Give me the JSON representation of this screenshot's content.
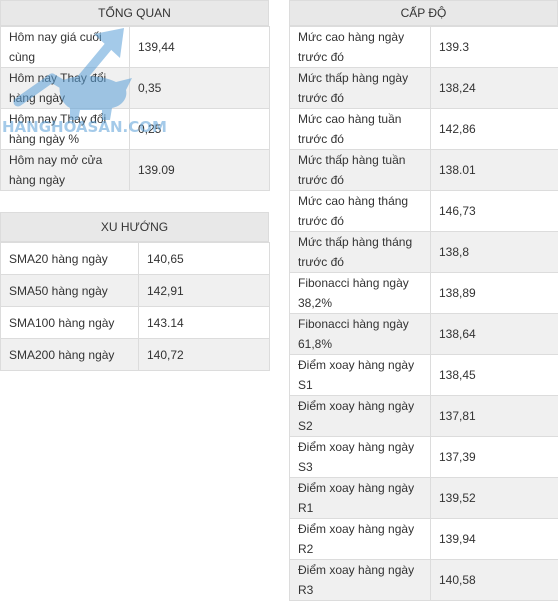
{
  "tong_quan": {
    "title": "TỔNG QUAN",
    "rows": [
      {
        "label": "Hôm nay giá cuối cùng",
        "value": "139,44"
      },
      {
        "label": "Hôm nay Thay đổi hàng ngày",
        "value": "0,35"
      },
      {
        "label": "Hôm nay Thay đổi hàng ngày %",
        "value": "0,25"
      },
      {
        "label": "Hôm nay mở cửa hàng ngày",
        "value": "139.09"
      }
    ]
  },
  "xu_huong": {
    "title": "XU HƯỚNG",
    "rows": [
      {
        "label": "SMA20 hàng ngày",
        "value": "140,65"
      },
      {
        "label": "SMA50 hàng ngày",
        "value": "142,91"
      },
      {
        "label": "SMA100 hàng ngày",
        "value": "143.14"
      },
      {
        "label": "SMA200 hàng ngày",
        "value": "140,72"
      }
    ]
  },
  "cap_do": {
    "title": "CẤP ĐỘ",
    "rows": [
      {
        "label": "Mức cao hàng ngày trước đó",
        "value": "139.3"
      },
      {
        "label": "Mức thấp hàng ngày trước đó",
        "value": "138,24"
      },
      {
        "label": "Mức cao hàng tuần trước đó",
        "value": "142,86"
      },
      {
        "label": "Mức thấp hàng tuần trước đó",
        "value": "138.01"
      },
      {
        "label": "Mức cao hàng tháng trước đó",
        "value": "146,73"
      },
      {
        "label": "Mức thấp hàng tháng trước đó",
        "value": "138,8"
      },
      {
        "label": "Fibonacci hàng ngày 38,2%",
        "value": "138,89"
      },
      {
        "label": "Fibonacci hàng ngày 61,8%",
        "value": "138,64"
      },
      {
        "label": "Điểm xoay hàng ngày S1",
        "value": "138,45"
      },
      {
        "label": "Điểm xoay hàng ngày S2",
        "value": "137,81"
      },
      {
        "label": "Điểm xoay hàng ngày S3",
        "value": "137,39"
      },
      {
        "label": "Điểm xoay hàng ngày R1",
        "value": "139,52"
      },
      {
        "label": "Điểm xoay hàng ngày R2",
        "value": "139,94"
      },
      {
        "label": "Điểm xoay hàng ngày R3",
        "value": "140,58"
      }
    ]
  },
  "watermark": {
    "text": "HANGHOASAN.COM"
  },
  "colors": {
    "header_bg": "#e8e8e8",
    "border": "#dcdcdc",
    "row_alt": "#f0f0f0",
    "text": "#333333",
    "watermark": "#5aa0d8"
  }
}
